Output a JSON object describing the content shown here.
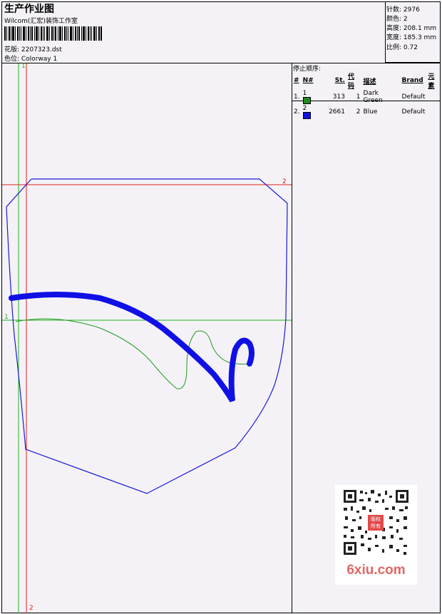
{
  "header": {
    "title": "生产作业图",
    "studio": "Wilcom(汇宏)装饰工作室",
    "design": "花版: 2207323.dst",
    "colorway": "色位: Colorway 1"
  },
  "stats": [
    {
      "label": "针数",
      "value": "2976"
    },
    {
      "label": "颜色",
      "value": "2"
    },
    {
      "label": "高度",
      "value": "208.1 mm"
    },
    {
      "label": "宽度",
      "value": "185.3 mm"
    },
    {
      "label": "比例",
      "value": "0.72"
    }
  ],
  "stop_sequence": {
    "label": "停止顺序:",
    "headers": [
      "#",
      "N#",
      "St.",
      "代码",
      "描述",
      "Brand",
      "元素"
    ],
    "rows": [
      {
        "num": "1.",
        "n": "1",
        "color": "#1f8a1f",
        "stitches": "313",
        "code": "1",
        "description": "Dark Green",
        "brand": "Default"
      },
      {
        "num": "2.",
        "n": "2",
        "color": "#1010e6",
        "stitches": "2661",
        "code": "2",
        "description": "Blue",
        "brand": "Default"
      }
    ]
  },
  "markers": {
    "v1_top": "1",
    "v2_bottom": "2",
    "h1_left": "1",
    "h2_right": "2"
  },
  "watermark": "6xiu.com",
  "seal_text": "版权所有",
  "colors": {
    "outline": "#1a1ad6",
    "fill_blue": "#1010e6",
    "green": "#1f9a1f",
    "red_guide": "#e02020",
    "green_guide": "#22b222"
  }
}
